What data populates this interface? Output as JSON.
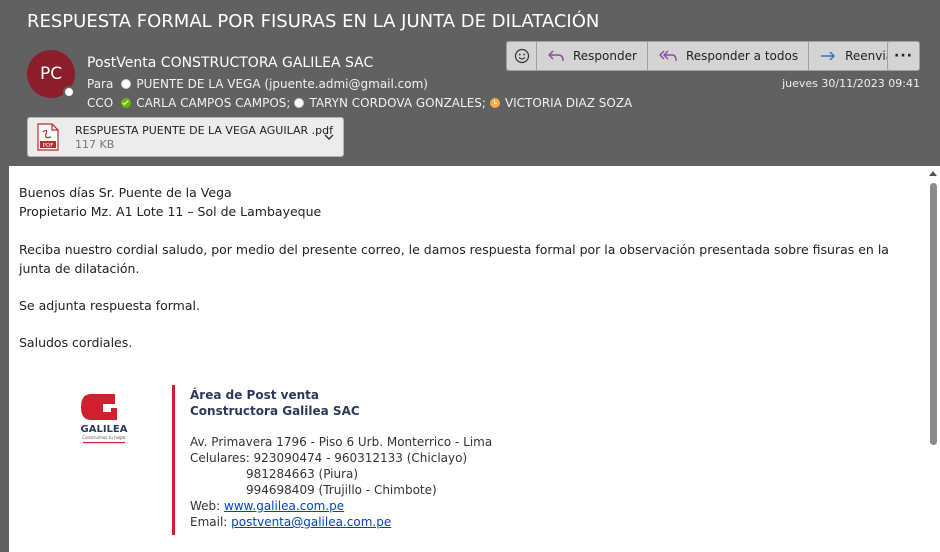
{
  "email": {
    "subject": "RESPUESTA FORMAL POR FISURAS EN LA JUNTA DE DILATACIÓN",
    "avatar_initials": "PC",
    "sender": "PostVenta CONSTRUCTORA GALILEA SAC",
    "to_label": "Para",
    "to": "PUENTE DE LA VEGA (jpuente.admi@gmail.com)",
    "cc_label": "CCO",
    "cc": [
      {
        "name": "CARLA CAMPOS CAMPOS;",
        "status": "available"
      },
      {
        "name": "TARYN CORDOVA GONZALES;",
        "status": "offline"
      },
      {
        "name": "VICTORIA DIAZ SOZA",
        "status": "away"
      }
    ],
    "date": "jueves 30/11/2023 09:41"
  },
  "actions": {
    "reply": "Responder",
    "reply_all": "Responder a todos",
    "forward": "Reenviar"
  },
  "attachment": {
    "name": "RESPUESTA PUENTE DE LA VEGA AGUILAR .pdf",
    "size": "117 KB",
    "icon_label": "PDF"
  },
  "body": {
    "greeting1": "Buenos días Sr. Puente de la Vega",
    "greeting2": "Propietario Mz. A1 Lote 11 – Sol de Lambayeque",
    "para1": "Reciba nuestro cordial saludo, por medio del presente correo, le damos respuesta formal por la observación presentada sobre fisuras en la junta de dilatación.",
    "para2": "Se adjunta respuesta formal.",
    "closing": "Saludos cordiales."
  },
  "signature": {
    "logo_text": "GALILEA",
    "logo_tagline": "Construimos tu hogar",
    "dept": "Área de Post venta",
    "company": "Constructora Galilea SAC",
    "address": "Av. Primavera 1796 - Piso 6 Urb. Monterrico - Lima",
    "phones_label": "Celulares: 923090474 - 960312133 (Chiclayo)",
    "phone2": "981284663 (Piura)",
    "phone3": "994698409 (Trujillo - Chimbote)",
    "web_label": "Web:",
    "web": "www.galilea.com.pe",
    "email_label": "Email:",
    "email": "postventa@galilea.com.pe"
  },
  "colors": {
    "header_bg": "#616161",
    "avatar": "#8a1e2a",
    "accent_red": "#d01f2e"
  }
}
